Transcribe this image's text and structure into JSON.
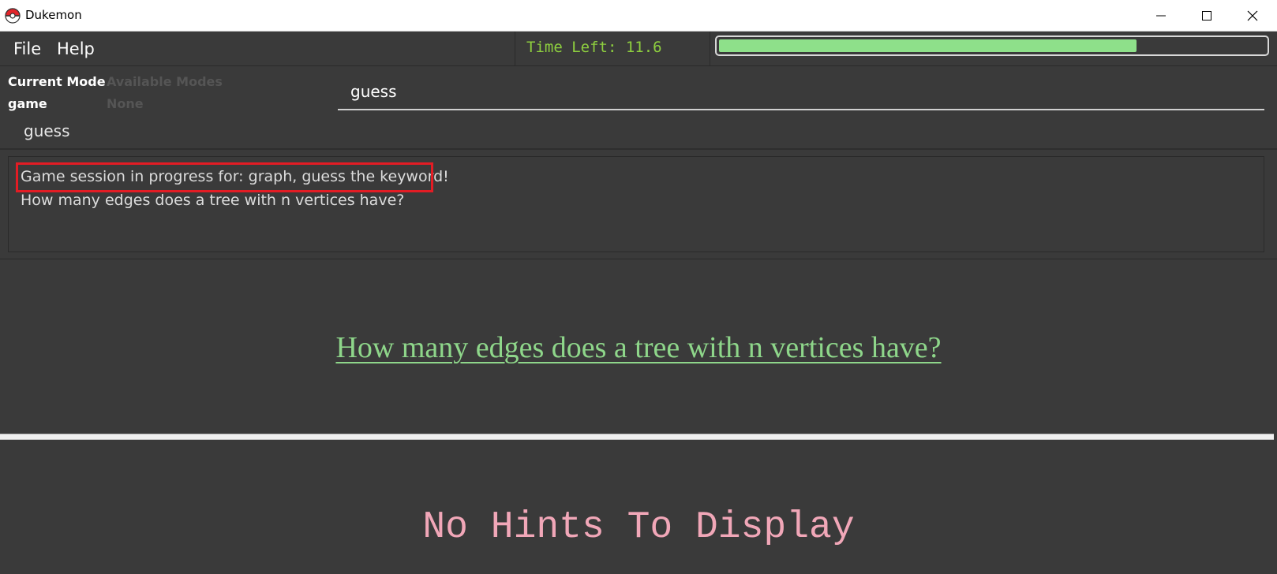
{
  "window": {
    "title": "Dukemon",
    "icon": "pokeball-icon"
  },
  "menu": {
    "items": [
      "File",
      "Help"
    ]
  },
  "timer": {
    "label": "Time Left: 11.6",
    "progress_fraction": 0.765,
    "progress_color": "#8ee08a"
  },
  "modes": {
    "current_mode_header": "Current Mode",
    "current_mode_value": "game",
    "available_modes_header": "Available Modes",
    "available_modes_value": "None",
    "sub_label": "guess"
  },
  "command_box": {
    "value": "guess"
  },
  "result_display": {
    "lines": [
      "Game session in progress for: graph, guess the keyword!",
      "How many edges does a tree with n vertices have?"
    ],
    "highlight_color": "#e31c24"
  },
  "question": {
    "text": "How many edges does a tree with n vertices have?",
    "color": "#8ed68a"
  },
  "hints": {
    "text": "No Hints To Display",
    "color": "#f1a7b8"
  }
}
